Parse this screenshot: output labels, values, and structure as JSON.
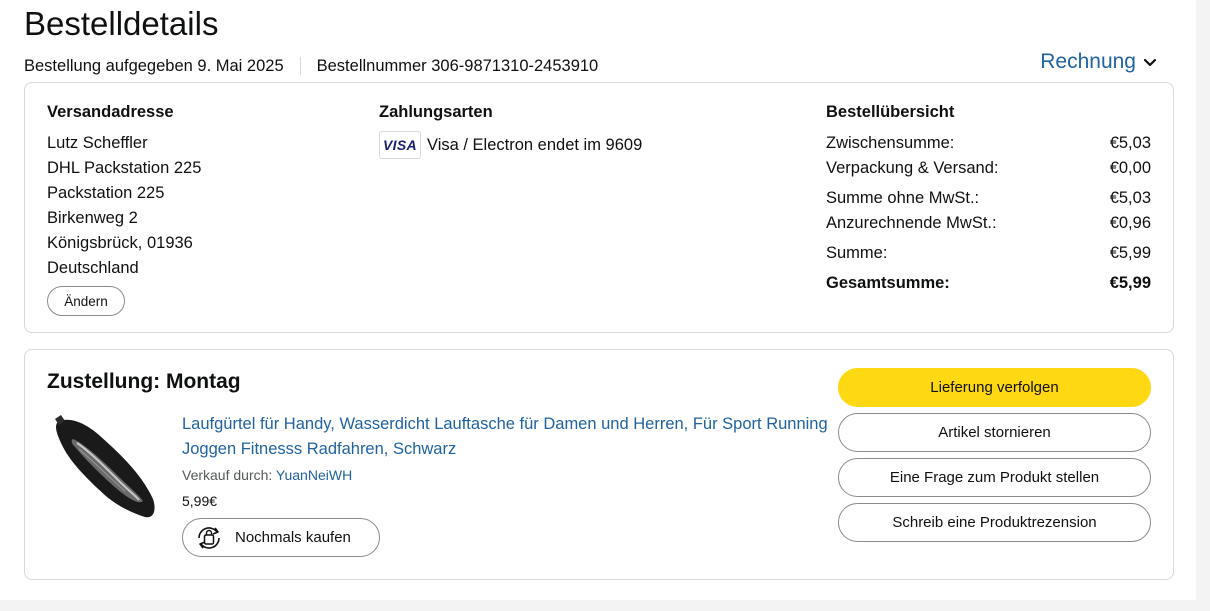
{
  "header": {
    "title": "Bestelldetails",
    "order_placed": "Bestellung aufgegeben 9. Mai 2025",
    "order_number": "Bestellnummer 306-9871310-2453910",
    "invoice_label": "Rechnung"
  },
  "shipping": {
    "title": "Versandadresse",
    "lines": [
      "Lutz Scheffler",
      "DHL Packstation 225",
      "Packstation 225",
      "Birkenweg 2",
      "Königsbrück, 01936",
      "Deutschland"
    ],
    "change_label": "Ändern"
  },
  "payment": {
    "title": "Zahlungsarten",
    "card_brand": "VISA",
    "card_text": "Visa / Electron endet im 9609"
  },
  "summary": {
    "title": "Bestellübersicht",
    "rows": [
      {
        "label": "Zwischensumme:",
        "value": "€5,03"
      },
      {
        "label": "Verpackung & Versand:",
        "value": "€0,00"
      },
      {
        "label": "Summe ohne MwSt.:",
        "value": "€5,03"
      },
      {
        "label": "Anzurechnende MwSt.:",
        "value": "€0,96"
      },
      {
        "label": "Summe:",
        "value": "€5,99"
      },
      {
        "label": "Gesamtsumme:",
        "value": "€5,99"
      }
    ]
  },
  "delivery": {
    "title": "Zustellung: Montag",
    "product_title": "Laufgürtel für Handy, Wasserdicht Lauftasche für Damen und Herren, Für Sport Running Joggen Fitnesss Radfahren, Schwarz",
    "seller_prefix": "Verkauf durch:",
    "seller_name": "YuanNeiWH",
    "price": "5,99€",
    "rebuy_label": "Nochmals kaufen"
  },
  "actions": {
    "track": "Lieferung verfolgen",
    "cancel": "Artikel stornieren",
    "question": "Eine Frage zum Produkt stellen",
    "review": "Schreib eine Produktrezension"
  },
  "colors": {
    "link": "#2162a1",
    "primary_button": "#ffd814",
    "border": "#d5d9d9"
  }
}
